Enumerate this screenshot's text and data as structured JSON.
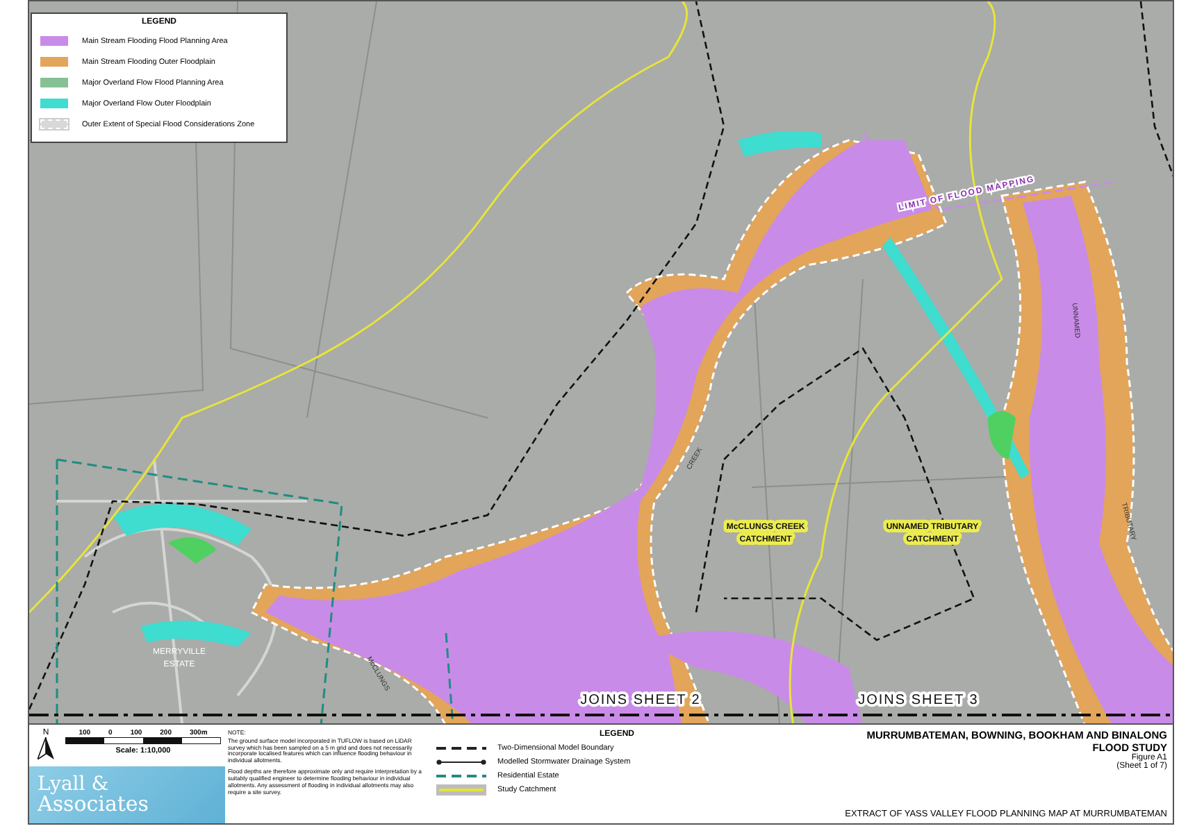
{
  "map_legend": {
    "title": "LEGEND",
    "items": [
      {
        "kind": "fill",
        "color": "#c98be8",
        "label": "Main Stream Flooding Flood Planning Area"
      },
      {
        "kind": "fill",
        "color": "#e2a55a",
        "label": "Main Stream Flooding Outer Floodplain"
      },
      {
        "kind": "fill",
        "color": "#86c196",
        "label": "Major Overland Flow Flood Planning Area"
      },
      {
        "kind": "fill",
        "color": "#3fdcd0",
        "label": "Major Overland Flow Outer Floodplain"
      },
      {
        "kind": "zone",
        "color": "#d8d8d8",
        "label": "Outer Extent of Special Flood Considerations Zone"
      }
    ]
  },
  "map_labels": [
    {
      "kind": "line",
      "text": "LIMIT OF FLOOD MAPPING"
    },
    {
      "kind": "creek",
      "text": "CREEK"
    },
    {
      "kind": "creek",
      "text": "McCLUNGS"
    },
    {
      "kind": "creek",
      "text": "UNNAMED"
    },
    {
      "kind": "creek",
      "text": "TRIBUTARY"
    },
    {
      "kind": "catchment",
      "text": "McCLUNGS CREEK CATCHMENT"
    },
    {
      "kind": "catchment",
      "text": "UNNAMED TRIBUTARY CATCHMENT"
    },
    {
      "kind": "estate",
      "text": "MERRYVILLE ESTATE"
    }
  ],
  "sheet_joins": [
    "JOINS SHEET 2",
    "JOINS SHEET 3"
  ],
  "scale": {
    "north": "N",
    "ticks": [
      "100",
      "0",
      "100",
      "200",
      "300m"
    ],
    "text": "Scale: 1:10,000"
  },
  "logo": {
    "line_1": "Lyall &",
    "line_2": "Associates"
  },
  "note": {
    "title": "NOTE:",
    "paragraphs": [
      "The ground surface model incorporated in TUFLOW is based on LiDAR survey which has been sampled on a 5 m grid and does not necessarily incorporate localised features which can influence flooding behaviour in individual allotments.",
      "Flood depths are therefore approximate only and require interpretation by a suitably qualified engineer to determine flooding behaviour in individual allotments. Any assessment of flooding in individual allotments may also require a site survey."
    ]
  },
  "line_legend": {
    "title": "LEGEND",
    "items": [
      {
        "kind": "dashed",
        "color": "#222222",
        "label": "Two-Dimensional Model Boundary"
      },
      {
        "kind": "dotted-line",
        "color": "#222222",
        "label": "Modelled Stormwater Drainage System"
      },
      {
        "kind": "dashed",
        "color": "#1f8c84",
        "label": "Residential Estate"
      },
      {
        "kind": "band",
        "color": "#e6e23a",
        "label": "Study Catchment"
      }
    ]
  },
  "title_block": {
    "title": "MURRUMBATEMAN, BOWNING, BOOKHAM AND BINALONG",
    "subtitle": "FLOOD STUDY",
    "figure": "Figure A1",
    "sheet": "(Sheet 1 of 7)",
    "caption": "EXTRACT OF YASS VALLEY FLOOD PLANNING MAP AT MURRUMBATEMAN"
  }
}
